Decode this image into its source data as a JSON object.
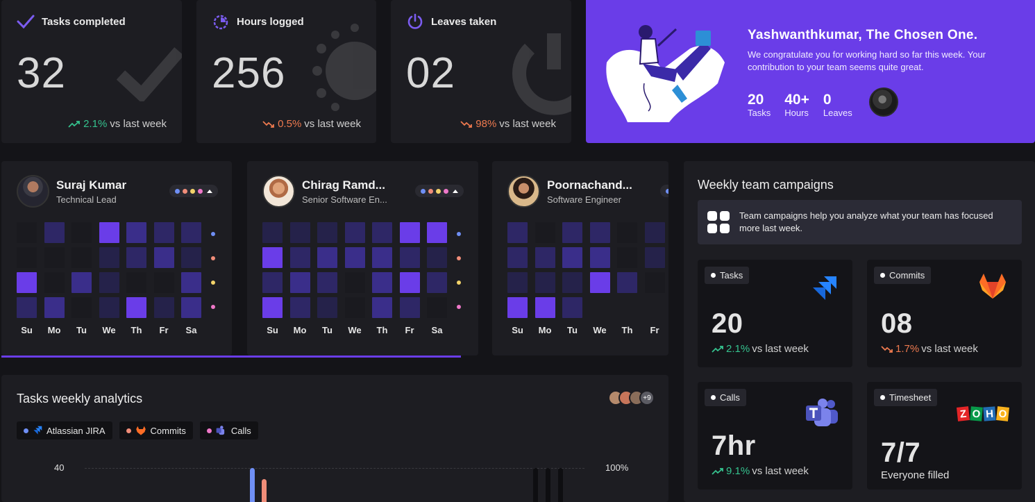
{
  "stats": [
    {
      "title": "Tasks completed",
      "value": "32",
      "trend_pct": "2.1%",
      "trend_dir": "up",
      "trend_suffix": "vs last week",
      "icon": "check-icon"
    },
    {
      "title": "Hours logged",
      "value": "256",
      "trend_pct": "0.5%",
      "trend_dir": "down",
      "trend_suffix": "vs last week",
      "icon": "timer-icon"
    },
    {
      "title": "Leaves taken",
      "value": "02",
      "trend_pct": "98%",
      "trend_dir": "down",
      "trend_suffix": "vs last week",
      "icon": "power-icon"
    }
  ],
  "hero": {
    "title": "Yashwanthkumar, The Chosen One.",
    "message": "We congratulate you for working hard so far this week. Your contribution to your team seems quite great.",
    "stats": [
      {
        "num": "20",
        "label": "Tasks"
      },
      {
        "num": "40+",
        "label": "Hours"
      },
      {
        "num": "0",
        "label": "Leaves"
      }
    ]
  },
  "people": [
    {
      "name": "Suraj Kumar",
      "role": "Technical Lead"
    },
    {
      "name": "Chirag Ramd...",
      "role": "Senior Software En..."
    },
    {
      "name": "Poornachand...",
      "role": "Software Engineer"
    }
  ],
  "days": [
    "Su",
    "Mo",
    "Tu",
    "We",
    "Th",
    "Fr",
    "Sa"
  ],
  "campaigns": {
    "title": "Weekly team campaigns",
    "info": "Team campaigns help you analyze what your team has focused more last week.",
    "items": [
      {
        "chip": "Tasks",
        "value": "20",
        "trend_pct": "2.1%",
        "trend_dir": "up",
        "trend_suffix": "vs last week",
        "icon": "jira-icon"
      },
      {
        "chip": "Commits",
        "value": "08",
        "trend_pct": "1.7%",
        "trend_dir": "down",
        "trend_suffix": "vs last week",
        "icon": "gitlab-icon"
      },
      {
        "chip": "Calls",
        "value": "7hr",
        "trend_pct": "9.1%",
        "trend_dir": "up",
        "trend_suffix": "vs last week",
        "icon": "teams-icon"
      },
      {
        "chip": "Timesheet",
        "value": "7/7",
        "sub": "Everyone filled",
        "icon": "zoho-icon",
        "zoho": [
          "Z",
          "O",
          "H",
          "O"
        ]
      }
    ]
  },
  "analytics": {
    "title": "Tasks weekly analytics",
    "legend": [
      "Atlassian JIRA",
      "Commits",
      "Calls"
    ],
    "more_count": "+9",
    "y_left_top": "40",
    "y_right_top": "100%"
  },
  "colors": {
    "accent": "#6a3de8",
    "up": "#35c28e",
    "down": "#ee7a4f",
    "dot_blue": "#6f8ff5",
    "dot_salmon": "#f08d79",
    "dot_yellow": "#f3d36a",
    "dot_pink": "#ef78c9"
  }
}
